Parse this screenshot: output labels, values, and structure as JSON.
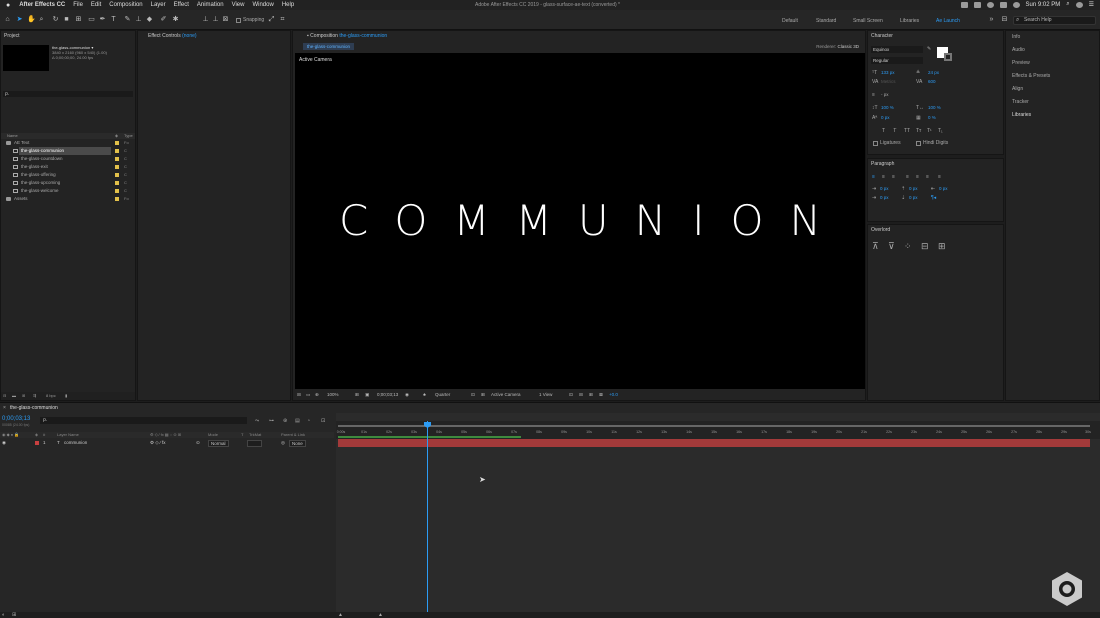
{
  "menubar": {
    "apple": "",
    "app": "After Effects CC",
    "menus": [
      "File",
      "Edit",
      "Composition",
      "Layer",
      "Effect",
      "Animation",
      "View",
      "Window",
      "Help"
    ],
    "window_title": "Adobe After Effects CC 2019 - glass-surface-ae-text (converted) *",
    "clock": "Sun 9:02 PM"
  },
  "toolbar": {
    "snapping": "Snapping",
    "workspaces": [
      "Default",
      "Standard",
      "Small Screen",
      "Libraries",
      "Ae Launch"
    ],
    "search_placeholder": "Search Help"
  },
  "project": {
    "title": "Project",
    "comp_name": "the-glass-communion ▾",
    "comp_size": "3840 x 2160  (960 x 540) (1.00)",
    "comp_dur": "Δ 0;00;00;00, 24.00 fps",
    "search": "ρ.",
    "col_name": "Name",
    "col_type": "Type",
    "items": [
      {
        "label": "AE Text",
        "type": "Fo"
      },
      {
        "label": "the-glass-communion",
        "type": "C"
      },
      {
        "label": "the-glass-countdown",
        "type": "C"
      },
      {
        "label": "the-glass-exit",
        "type": "C"
      },
      {
        "label": "the-glass-offering",
        "type": "C"
      },
      {
        "label": "the-glass-upcoming",
        "type": "C"
      },
      {
        "label": "the-glass-welcome",
        "type": "C"
      },
      {
        "label": "Assets",
        "type": "Fo"
      }
    ],
    "bpc": "8 bpc"
  },
  "effects": {
    "title": "Effect Controls",
    "title_note": "(none)"
  },
  "comp": {
    "title_prefix": "Composition",
    "title_name": "the-glass-communion",
    "tab": "the-glass-communion",
    "renderer_label": "Renderer:",
    "renderer_value": "Classic 3D",
    "active_camera": "Active Camera",
    "main_text": "COMMUNION",
    "footer": {
      "zoom": "100%",
      "timecode": "0;00;03;13",
      "resolution": "Quarter",
      "view": "Active Camera",
      "views": "1 View",
      "exposure": "+0.0"
    }
  },
  "character": {
    "title": "Character",
    "font": "Equinox",
    "style": "Regular",
    "size": "133 px",
    "leading": "24 px",
    "kerning": "Metrics",
    "tracking": "600",
    "stroke": "- px",
    "vscale": "100 %",
    "hscale": "100 %",
    "baseline": "0 px",
    "tsume": "0 %",
    "ligatures": "Ligatures",
    "hindi": "Hindi Digits"
  },
  "paragraph": {
    "title": "Paragraph",
    "indent_left": "0 px",
    "indent_right": "0 px",
    "space_before": "0 px",
    "first_line": "0 px",
    "space_after": "0 px"
  },
  "overlord": {
    "title": "Overlord"
  },
  "rightstack": {
    "items": [
      "Info",
      "Audio",
      "Preview",
      "Effects & Presets",
      "Align",
      "Tracker",
      "Libraries"
    ]
  },
  "timeline": {
    "tab": "the-glass-communion",
    "time": "0;00;03;13",
    "frames": "00085 (24.00 fps)",
    "search": "ρ.",
    "cols": {
      "num": "#",
      "name": "Layer Name",
      "mode": "Mode",
      "t": "T",
      "trkmat": "TrkMat",
      "parent": "Parent & Link"
    },
    "layer": {
      "num": "1",
      "name": "communion",
      "mode": "Normal",
      "parent": "None"
    },
    "ticks": [
      "0:00s",
      "01s",
      "02s",
      "03s",
      "04s",
      "05s",
      "06s",
      "07s",
      "08s",
      "09s",
      "10s",
      "11s",
      "12s",
      "13s",
      "14s",
      "15s",
      "16s",
      "17s",
      "18s",
      "19s",
      "20s",
      "21s",
      "22s",
      "23s",
      "24s",
      "25s",
      "26s",
      "27s",
      "28s",
      "29s",
      "30s"
    ]
  },
  "colors": {
    "accent": "#2c9cf5",
    "layer_bar": "#a33a3a",
    "label_yellow": "#e3c14a"
  }
}
